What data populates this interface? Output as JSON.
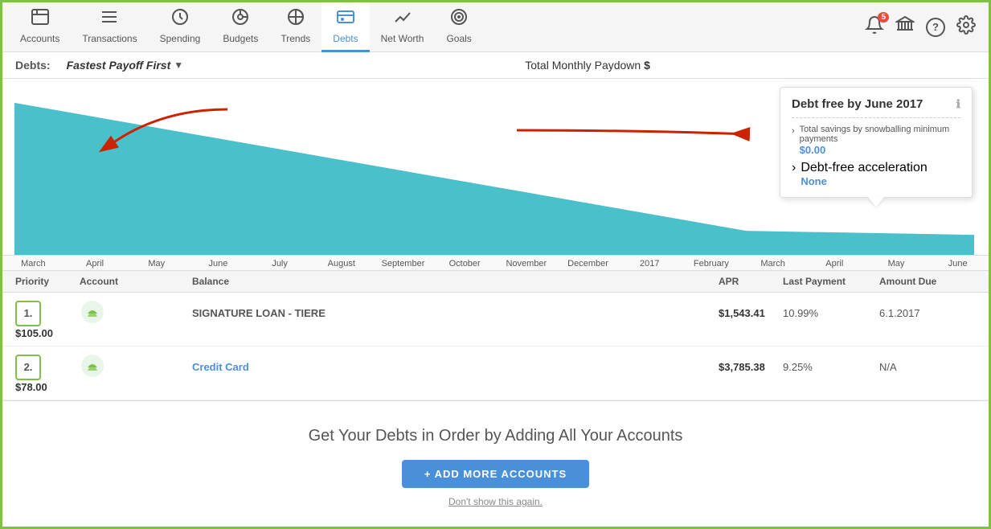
{
  "nav": {
    "items": [
      {
        "label": "Accounts",
        "icon": "🏠",
        "active": false
      },
      {
        "label": "Transactions",
        "icon": "☰",
        "active": false
      },
      {
        "label": "Spending",
        "icon": "↻",
        "active": false
      },
      {
        "label": "Budgets",
        "icon": "⏱",
        "active": false
      },
      {
        "label": "Trends",
        "icon": "⏲",
        "active": false
      },
      {
        "label": "Debts",
        "icon": "💳",
        "active": true
      },
      {
        "label": "Net Worth",
        "icon": "📈",
        "active": false
      },
      {
        "label": "Goals",
        "icon": "🎯",
        "active": false
      }
    ],
    "badge_count": "5",
    "icons": [
      "🔔",
      "🏛",
      "?",
      "⚙"
    ]
  },
  "toolbar": {
    "label": "Debts:",
    "strategy": "Fastest Payoff First",
    "monthly_paydown_label": "Total Monthly Paydown",
    "monthly_paydown_value": "$"
  },
  "chart": {
    "months": [
      "March",
      "April",
      "May",
      "June",
      "July",
      "August",
      "September",
      "October",
      "November",
      "December",
      "2017",
      "February",
      "March",
      "April",
      "May",
      "June"
    ]
  },
  "info_box": {
    "title": "Debt free by June 2017",
    "savings_label": "Total savings by snowballing minimum payments",
    "savings_value": "$0.00",
    "acceleration_label": "Debt-free acceleration",
    "acceleration_value": "None"
  },
  "table": {
    "headers": [
      "Priority",
      "Account",
      "Balance",
      "",
      "APR",
      "Last Payment",
      "Amount Due"
    ],
    "rows": [
      {
        "priority": "1.",
        "account": "SIGNATURE LOAN - TIERE",
        "linked": false,
        "balance": "$1,543.41",
        "apr": "10.99%",
        "last_payment": "6.1.2017",
        "amount_due": "$105.00"
      },
      {
        "priority": "2.",
        "account": "Credit Card",
        "linked": true,
        "balance": "$3,785.38",
        "apr": "9.25%",
        "last_payment": "N/A",
        "amount_due": "$78.00"
      }
    ]
  },
  "cta": {
    "title": "Get Your Debts in Order by Adding All Your Accounts",
    "button_label": "+ ADD MORE ACCOUNTS",
    "link_label": "Don't show this again."
  }
}
